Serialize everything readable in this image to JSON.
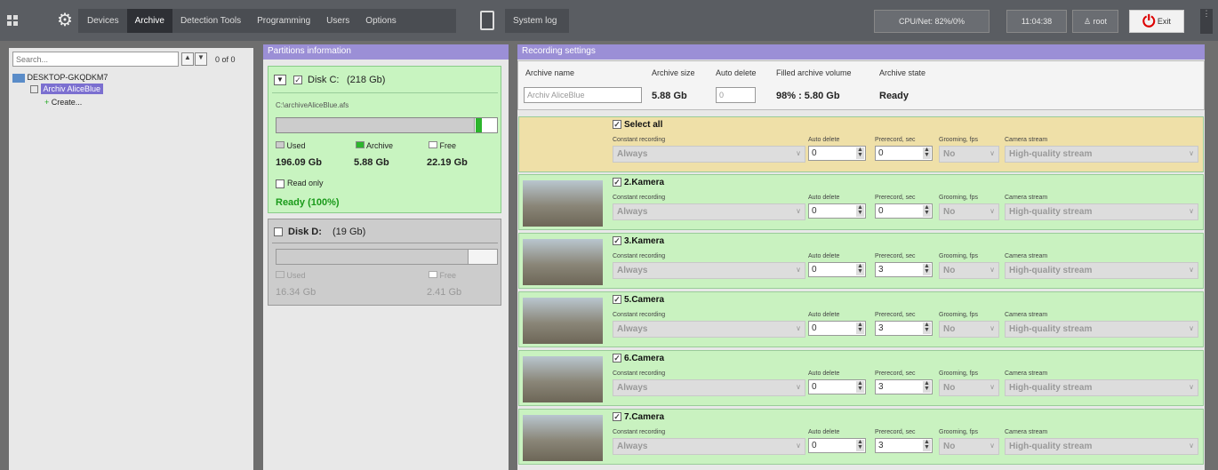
{
  "topbar": {
    "tabs": [
      "Devices",
      "Archive",
      "Detection Tools",
      "Programming",
      "Users",
      "Options"
    ],
    "system_log": "System log",
    "cpu": "CPU/Net: 82%/0%",
    "time": "11:04:38",
    "user": "root",
    "exit": "Exit"
  },
  "tree": {
    "search_placeholder": "Search...",
    "counter": "0 of 0",
    "computer": "DESKTOP-GKQDKM7",
    "archive": "Archiv AliceBlue",
    "create": "Create..."
  },
  "partitions": {
    "title": "Partitions information",
    "diskc": {
      "name": "Disk C:",
      "size": "(218 Gb)",
      "path": "C:\\archiveAliceBlue.afs",
      "used_label": "Used",
      "archive_label": "Archive",
      "free_label": "Free",
      "used": "196.09 Gb",
      "archive": "5.88 Gb",
      "free": "22.19 Gb",
      "readonly": "Read only",
      "status": "Ready (100%)",
      "used_fraction": 0.9,
      "archive_fraction": 0.027
    },
    "diskd": {
      "name": "Disk D:",
      "size": "(19 Gb)",
      "used_label": "Used",
      "free_label": "Free",
      "used": "16.34 Gb",
      "free": "2.41 Gb",
      "used_fraction": 0.87
    }
  },
  "recording": {
    "title": "Recording settings",
    "headers": [
      "Archive name",
      "Archive size",
      "Auto delete",
      "Filled archive volume",
      "Archive state"
    ],
    "archive_name": "Archiv AliceBlue",
    "archive_size": "5.88 Gb",
    "auto_delete": "0",
    "filled": "98% : 5.80 Gb",
    "state": "Ready"
  },
  "labels": {
    "constant": "Constant recording",
    "autodel": "Auto delete",
    "prerecord": "Prerecord, sec",
    "grooming": "Grooming, fps",
    "stream": "Camera stream"
  },
  "rows": [
    {
      "name": "Select all",
      "mode": "Always",
      "autodel": "0",
      "pre": "0",
      "groom": "No",
      "stream": "High-quality stream"
    },
    {
      "name": "2.Kamera",
      "mode": "Always",
      "autodel": "0",
      "pre": "0",
      "groom": "No",
      "stream": "High-quality stream"
    },
    {
      "name": "3.Kamera",
      "mode": "Always",
      "autodel": "0",
      "pre": "3",
      "groom": "No",
      "stream": "High-quality stream"
    },
    {
      "name": "5.Camera",
      "mode": "Always",
      "autodel": "0",
      "pre": "3",
      "groom": "No",
      "stream": "High-quality stream"
    },
    {
      "name": "6.Camera",
      "mode": "Always",
      "autodel": "0",
      "pre": "3",
      "groom": "No",
      "stream": "High-quality stream"
    },
    {
      "name": "7.Camera",
      "mode": "Always",
      "autodel": "0",
      "pre": "3",
      "groom": "No",
      "stream": "High-quality stream"
    }
  ]
}
